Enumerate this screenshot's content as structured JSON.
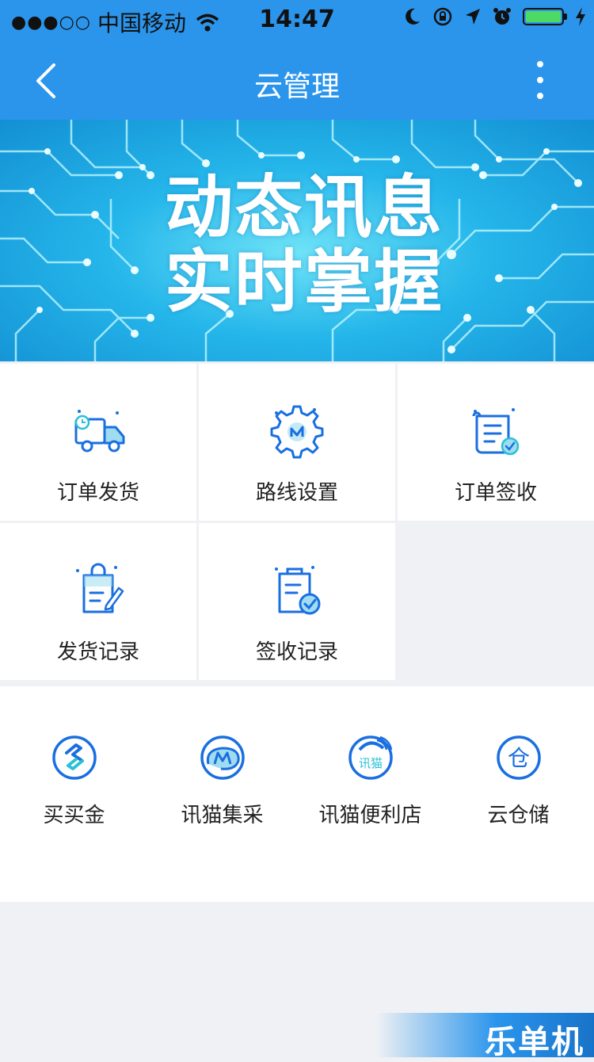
{
  "status_bar": {
    "signal": "●●●○○",
    "carrier": "中国移动",
    "time": "14:47"
  },
  "nav": {
    "title": "云管理"
  },
  "banner": {
    "line1": "动态讯息",
    "line2": "实时掌握"
  },
  "grid": {
    "items": [
      {
        "label": "订单发货",
        "icon": "delivery-truck-icon"
      },
      {
        "label": "路线设置",
        "icon": "route-settings-gear-icon"
      },
      {
        "label": "订单签收",
        "icon": "order-receipt-check-icon"
      },
      {
        "label": "发货记录",
        "icon": "shipping-record-clipboard-icon"
      },
      {
        "label": "签收记录",
        "icon": "receipt-record-clipboard-icon"
      }
    ]
  },
  "services": {
    "items": [
      {
        "label": "买买金",
        "icon": "maimaijin-icon"
      },
      {
        "label": "讯猫集采",
        "icon": "xunmao-purchase-icon"
      },
      {
        "label": "讯猫便利店",
        "icon": "xunmao-store-icon",
        "icon_text": "讯猫"
      },
      {
        "label": "云仓储",
        "icon": "cloud-storage-icon",
        "icon_text": "仓"
      }
    ]
  },
  "watermark": {
    "text": "乐单机"
  },
  "colors": {
    "primary": "#2b95ec",
    "icon_blue": "#1a6fe0",
    "icon_cyan": "#29c0d8",
    "background": "#eff1f4"
  }
}
